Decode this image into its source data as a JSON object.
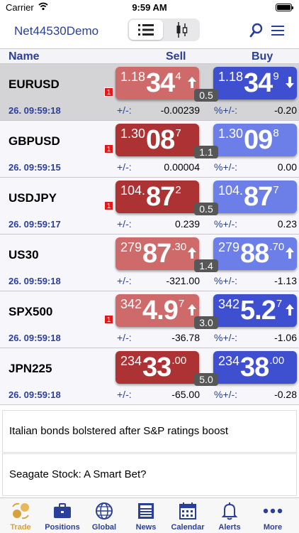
{
  "status_bar": {
    "carrier": "Carrier",
    "time": "9:59 AM"
  },
  "nav": {
    "title": "Net44530Demo"
  },
  "columns": {
    "name": "Name",
    "sell": "Sell",
    "buy": "Buy"
  },
  "quotes": [
    {
      "symbol": "EURUSD",
      "time": "26. 09:59:18",
      "badge": "1",
      "spread": "0.5",
      "sell": {
        "small": "1.18",
        "big": "34",
        "sup": "4",
        "direction": "up"
      },
      "buy": {
        "small": "1.18",
        "big": "34",
        "sup": "9",
        "direction": "down"
      },
      "change_label": "+/-:",
      "change": "-0.00239",
      "pct_label": "%+/-:",
      "pct": "-0.20"
    },
    {
      "symbol": "GBPUSD",
      "time": "26. 09:59:15",
      "badge": "1",
      "spread": "1.1",
      "sell": {
        "small": "1.30",
        "big": "08",
        "sup": "7",
        "direction": "none"
      },
      "buy": {
        "small": "1.30",
        "big": "09",
        "sup": "8",
        "direction": "none"
      },
      "change_label": "+/-:",
      "change": "0.00004",
      "pct_label": "%+/-:",
      "pct": "0.00"
    },
    {
      "symbol": "USDJPY",
      "time": "26. 09:59:17",
      "badge": "1",
      "spread": "0.5",
      "sell": {
        "small": "104.",
        "big": "87",
        "sup": "2",
        "direction": "none"
      },
      "buy": {
        "small": "104.",
        "big": "87",
        "sup": "7",
        "direction": "none"
      },
      "change_label": "+/-:",
      "change": "0.239",
      "pct_label": "%+/-:",
      "pct": "0.23"
    },
    {
      "symbol": "US30",
      "time": "26. 09:59:18",
      "badge": "",
      "spread": "1.4",
      "sell": {
        "small": "279",
        "big": "87",
        "sup": ".30",
        "direction": "up"
      },
      "buy": {
        "small": "279",
        "big": "88",
        "sup": ".70",
        "direction": "up"
      },
      "change_label": "+/-:",
      "change": "-321.00",
      "pct_label": "%+/-:",
      "pct": "-1.13"
    },
    {
      "symbol": "SPX500",
      "time": "26. 09:59:18",
      "badge": "1",
      "spread": "3.0",
      "sell": {
        "small": "342",
        "big": "4.9",
        "sup": "7",
        "direction": "up"
      },
      "buy": {
        "small": "342",
        "big": "5.2",
        "sup": "7",
        "direction": "up"
      },
      "change_label": "+/-:",
      "change": "-36.78",
      "pct_label": "%+/-:",
      "pct": "-1.06"
    },
    {
      "symbol": "JPN225",
      "time": "26. 09:59:18",
      "badge": "",
      "spread": "5.0",
      "sell": {
        "small": "234",
        "big": "33",
        "sup": ".00",
        "direction": "none"
      },
      "buy": {
        "small": "234",
        "big": "38",
        "sup": ".00",
        "direction": "none"
      },
      "change_label": "+/-:",
      "change": "-65.00",
      "pct_label": "%+/-:",
      "pct": "-0.28"
    }
  ],
  "news": [
    {
      "headline": "Italian bonds bolstered after S&P ratings boost"
    },
    {
      "headline": "Seagate Stock: A Smart Bet?"
    }
  ],
  "tabs": [
    {
      "label": "Trade",
      "icon": "trade-icon"
    },
    {
      "label": "Positions",
      "icon": "briefcase-icon"
    },
    {
      "label": "Global",
      "icon": "globe-icon"
    },
    {
      "label": "News",
      "icon": "newspaper-icon"
    },
    {
      "label": "Calendar",
      "icon": "calendar-icon"
    },
    {
      "label": "Alerts",
      "icon": "bell-icon"
    },
    {
      "label": "More",
      "icon": "more-icon"
    }
  ],
  "colors": {
    "accent": "#2a3f9a",
    "sell_dark": "#ad3234",
    "sell_light": "#cf6a6b",
    "buy_dark": "#3e50d0",
    "buy_light": "#6c7fe8",
    "active_tab": "#d9a13b",
    "badge": "#e01a1a"
  }
}
